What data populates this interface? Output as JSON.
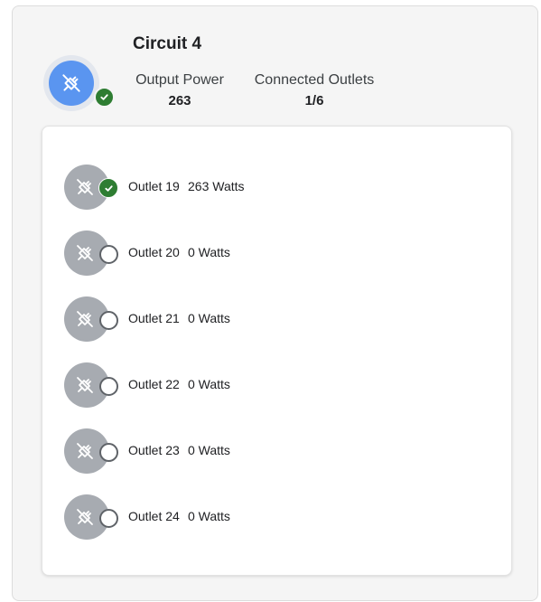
{
  "circuit": {
    "title": "Circuit 4",
    "icon": "plug-off-icon",
    "status": "connected",
    "output_power_label": "Output Power",
    "output_power_value": "263",
    "connected_outlets_label": "Connected Outlets",
    "connected_outlets_value": "1/6",
    "accent_color": "#5a95f0",
    "status_color": "#2e7d32"
  },
  "outlets": [
    {
      "name": "Outlet 19",
      "watts": "263 Watts",
      "connected": true
    },
    {
      "name": "Outlet 20",
      "watts": "0 Watts",
      "connected": false
    },
    {
      "name": "Outlet 21",
      "watts": "0 Watts",
      "connected": false
    },
    {
      "name": "Outlet 22",
      "watts": "0 Watts",
      "connected": false
    },
    {
      "name": "Outlet 23",
      "watts": "0 Watts",
      "connected": false
    },
    {
      "name": "Outlet 24",
      "watts": "0 Watts",
      "connected": false
    }
  ]
}
